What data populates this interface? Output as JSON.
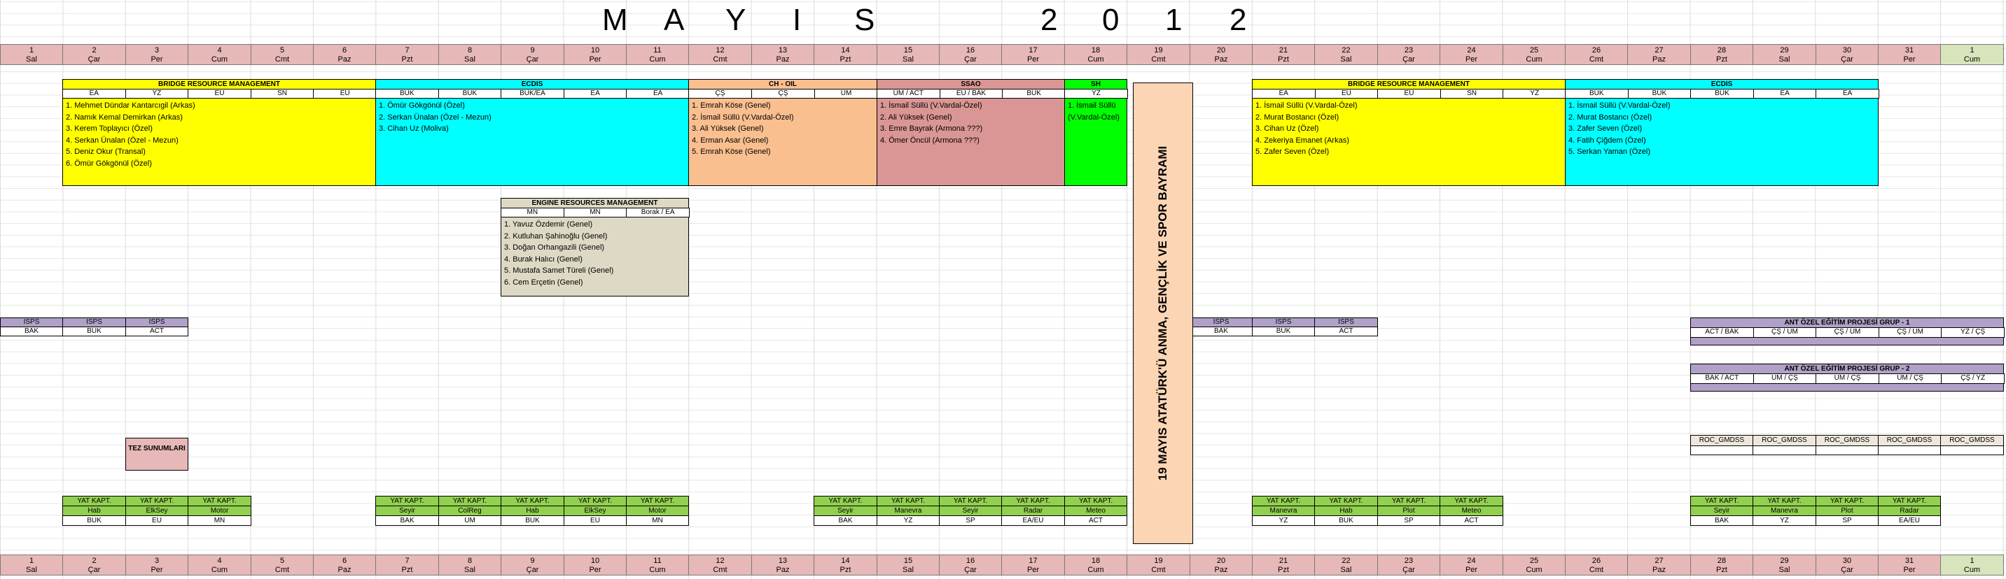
{
  "title_letters": [
    "M",
    "A",
    "Y",
    "I",
    "S",
    "2",
    "0",
    "1",
    "2"
  ],
  "days": [
    {
      "n": "1",
      "d": "Sal"
    },
    {
      "n": "2",
      "d": "Çar"
    },
    {
      "n": "3",
      "d": "Per"
    },
    {
      "n": "4",
      "d": "Cum"
    },
    {
      "n": "5",
      "d": "Cmt"
    },
    {
      "n": "6",
      "d": "Paz"
    },
    {
      "n": "7",
      "d": "Pzt"
    },
    {
      "n": "8",
      "d": "Sal"
    },
    {
      "n": "9",
      "d": "Çar"
    },
    {
      "n": "10",
      "d": "Per"
    },
    {
      "n": "11",
      "d": "Cum"
    },
    {
      "n": "12",
      "d": "Cmt"
    },
    {
      "n": "13",
      "d": "Paz"
    },
    {
      "n": "14",
      "d": "Pzt"
    },
    {
      "n": "15",
      "d": "Sal"
    },
    {
      "n": "16",
      "d": "Çar"
    },
    {
      "n": "17",
      "d": "Per"
    },
    {
      "n": "18",
      "d": "Cum"
    },
    {
      "n": "19",
      "d": "Cmt"
    },
    {
      "n": "20",
      "d": "Paz"
    },
    {
      "n": "21",
      "d": "Pzt"
    },
    {
      "n": "22",
      "d": "Sal"
    },
    {
      "n": "23",
      "d": "Çar"
    },
    {
      "n": "24",
      "d": "Per"
    },
    {
      "n": "25",
      "d": "Cum"
    },
    {
      "n": "26",
      "d": "Cmt"
    },
    {
      "n": "27",
      "d": "Paz"
    },
    {
      "n": "28",
      "d": "Pzt"
    },
    {
      "n": "29",
      "d": "Sal"
    },
    {
      "n": "30",
      "d": "Çar"
    },
    {
      "n": "31",
      "d": "Per"
    },
    {
      "n": "1",
      "d": "Cum"
    }
  ],
  "brm1": {
    "title": "BRIDGE RESOURCE MANAGEMENT",
    "subs": [
      "EA",
      "YZ",
      "EU",
      "SN",
      "EU"
    ],
    "items": [
      "1. Mehmet Dündar Kantarcıgil (Arkas)",
      "2. Namık Kemal Demirkan (Arkas)",
      "3. Kerem Toplayıcı (Özel)",
      "4. Serkan Ünalan (Özel - Mezun)",
      "5. Deniz Okur (Transal)",
      "6. Ömür Gökgönül (Özel)"
    ]
  },
  "ecdis1": {
    "title": "ECDIS",
    "subs": [
      "BUK",
      "BUK",
      "BUK/EA",
      "EA",
      "EA"
    ],
    "items": [
      "1. Ömür Gökgönül (Özel)",
      "2. Serkan Ünalan (Özel - Mezun)",
      "3. Cihan Uz (Moliva)"
    ]
  },
  "choil": {
    "title": "CH - OIL",
    "subs": [
      "ÇŞ",
      "ÇŞ",
      "UM"
    ],
    "items": [
      "1. Emrah Köse (Genel)",
      "2. İsmail Süllü (V.Vardal-Özel)",
      "3. Ali Yüksek (Genel)",
      "4. Erman Asar (Genel)",
      "5. Emrah Köse (Genel)"
    ]
  },
  "ssao": {
    "title": "SSAO",
    "subs": [
      "UM / ACT",
      "EU / BAK",
      "BUK"
    ],
    "items": [
      "1. İsmail Süllü (V.Vardal-Özel)",
      "2. Ali Yüksek (Genel)",
      "3. Emre Bayrak (Armona ???)",
      "4. Ömer Öncül (Armona ???)"
    ]
  },
  "sh": {
    "title": "SH",
    "subs": [
      "YZ"
    ],
    "items": [
      "1. İsmail Süllü",
      "(V.Vardal-Özel)"
    ]
  },
  "brm2": {
    "title": "BRIDGE RESOURCE MANAGEMENT",
    "subs": [
      "EA",
      "EU",
      "EU",
      "SN",
      "YZ"
    ],
    "items": [
      "1. İsmail Süllü (V.Vardal-Özel)",
      "2. Murat Bostancı (Özel)",
      "3. Cihan Uz (Özel)",
      "4. Zekeriya Emanet (Arkas)",
      "5. Zafer Seven (Özel)"
    ]
  },
  "ecdis2": {
    "title": "ECDIS",
    "subs": [
      "BUK",
      "BUK",
      "BUK",
      "EA",
      "EA"
    ],
    "items": [
      "1. İsmail Süllü (V.Vardal-Özel)",
      "2. Murat Bostancı (Özel)",
      "3. Zafer Seven (Özel)",
      "4. Fatih Çiğdem (Özel)",
      "5. Serkan Yaman (Özel)"
    ]
  },
  "erm": {
    "title": "ENGINE RESOURCES MANAGEMENT",
    "subs": [
      "MN",
      "MN",
      "Borak / EA"
    ],
    "items": [
      "1. Yavuz Özdemir (Genel)",
      "2. Kutluhan Şahinoğlu (Genel)",
      "3. Doğan Orhangazili (Genel)",
      "4. Burak Halıcı (Genel)",
      "5. Mustafa Samet Türeli (Genel)",
      "6. Cem Erçetin (Genel)"
    ]
  },
  "holiday": "19 MAYIS ATATÜRK'Ü ANMA, GENÇLİK VE SPOR BAYRAMI",
  "isps1": {
    "tops": [
      "ISPS",
      "ISPS",
      "ISPS"
    ],
    "subs": [
      "BAK",
      "BUK",
      "ACT"
    ]
  },
  "isps2": {
    "tops": [
      "ISPS",
      "ISPS",
      "ISPS"
    ],
    "subs": [
      "BAK",
      "BUK",
      "ACT"
    ]
  },
  "ant1": {
    "title": "ANT ÖZEL EĞİTİM PROJESİ GRUP - 1",
    "subs": [
      "ACT / BAK",
      "ÇŞ / UM",
      "ÇŞ / UM",
      "ÇŞ / UM",
      "YZ / ÇŞ"
    ]
  },
  "ant2": {
    "title": "ANT ÖZEL EĞİTİM PROJESİ GRUP - 2",
    "subs": [
      "BAK / ACT",
      "UM / ÇŞ",
      "UM / ÇŞ",
      "UM / ÇŞ",
      "ÇŞ / YZ"
    ]
  },
  "roc": [
    "ROC_GMDSS",
    "ROC_GMDSS",
    "ROC_GMDSS",
    "ROC_GMDSS",
    "ROC_GMDSS"
  ],
  "tez": "TEZ SUNUMLARI",
  "yat_top": "YAT KAPT.",
  "yat1": {
    "mid": [
      "Hab",
      "ElkSey",
      "Motor"
    ],
    "bot": [
      "BUK",
      "EU",
      "MN"
    ]
  },
  "yat2": {
    "mid": [
      "Seyir",
      "ColReg",
      "Hab",
      "ElkSey",
      "Motor"
    ],
    "bot": [
      "BAK",
      "UM",
      "BUK",
      "EU",
      "MN"
    ]
  },
  "yat3": {
    "mid": [
      "Seyir",
      "Manevra",
      "Seyir",
      "Radar",
      "Meteo"
    ],
    "bot": [
      "BAK",
      "YZ",
      "SP",
      "EA/EU",
      "ACT"
    ]
  },
  "yat4": {
    "mid": [
      "Manevra",
      "Hab",
      "Plot",
      "Meteo"
    ],
    "bot": [
      "YZ",
      "BUK",
      "SP",
      "ACT"
    ]
  },
  "yat5": {
    "mid": [
      "Seyir",
      "Manevra",
      "Plot",
      "Radar"
    ],
    "bot": [
      "BAK",
      "YZ",
      "SP",
      "EA/EU"
    ]
  },
  "colors": {
    "day": "#e6b8b7",
    "day_next_month": "#d8e4bc",
    "brm": "#ffff00",
    "ecdis": "#00ffff",
    "choil": "#fabf8f",
    "ssao": "#da9694",
    "sh": "#00ff00",
    "erm": "#ddd9c4",
    "isps": "#b1a0c7",
    "yat": "#92d050",
    "holiday": "#fcd5b4"
  }
}
